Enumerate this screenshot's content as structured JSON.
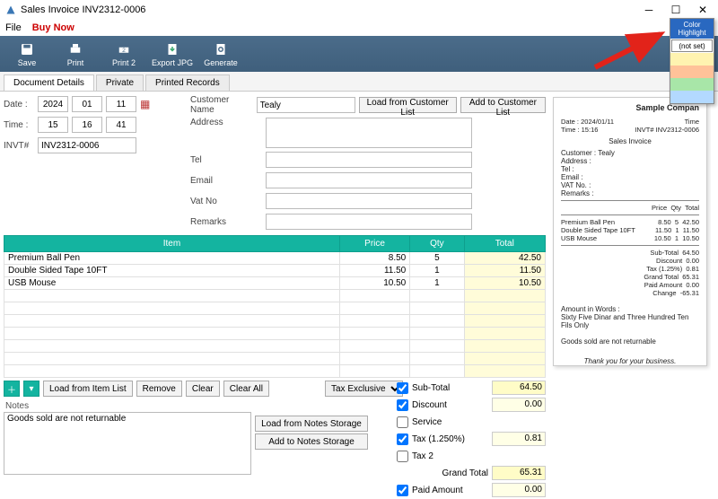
{
  "title": "Sales Invoice INV2312-0006",
  "menu": {
    "file": "File",
    "buy_now": "Buy Now"
  },
  "toolbar": {
    "save": "Save",
    "print": "Print",
    "print2": "Print 2",
    "exportjpg": "Export JPG",
    "generate": "Generate"
  },
  "tabs": {
    "doc": "Document Details",
    "private": "Private",
    "printed": "Printed Records"
  },
  "form": {
    "date_lbl": "Date :",
    "date_y": "2024",
    "date_m": "01",
    "date_d": "11",
    "time_lbl": "Time :",
    "time_h": "15",
    "time_m": "16",
    "time_s": "41",
    "invt_lbl": "INVT#",
    "invt": "INV2312-0006",
    "cust_lbl": "Customer Name",
    "cust": "Tealy",
    "load_cust": "Load from Customer List",
    "add_cust": "Add to Customer List",
    "addr_lbl": "Address",
    "addr": "",
    "tel_lbl": "Tel",
    "tel": "",
    "email_lbl": "Email",
    "email": "",
    "vat_lbl": "Vat No",
    "vat": "",
    "remarks_lbl": "Remarks",
    "remarks": ""
  },
  "item_cols": {
    "item": "Item",
    "price": "Price",
    "qty": "Qty",
    "total": "Total"
  },
  "items": [
    {
      "name": "Premium Ball Pen",
      "price": "8.50",
      "qty": "5",
      "total": "42.50"
    },
    {
      "name": "Double Sided Tape 10FT",
      "price": "11.50",
      "qty": "1",
      "total": "11.50"
    },
    {
      "name": "USB Mouse",
      "price": "10.50",
      "qty": "1",
      "total": "10.50"
    }
  ],
  "item_bar": {
    "load": "Load from Item List",
    "remove": "Remove",
    "clear": "Clear",
    "clear_all": "Clear All",
    "tax_mode": "Tax Exclusive"
  },
  "notes": {
    "header": "Notes",
    "text": "Goods sold are not returnable",
    "load": "Load from Notes Storage",
    "add": "Add to Notes Storage"
  },
  "totals": {
    "sub_lbl": "Sub-Total",
    "sub": "64.50",
    "disc_lbl": "Discount",
    "disc": "0.00",
    "svc_lbl": "Service",
    "tax_lbl": "Tax (1.250%)",
    "tax": "0.81",
    "tax2_lbl": "Tax 2",
    "grand_lbl": "Grand Total",
    "grand": "65.31",
    "paid_lbl": "Paid Amount",
    "paid": "0.00"
  },
  "preview": {
    "company": "Sample Compan",
    "date_lbl": "Date :",
    "date": "2024/01/11",
    "time_lbl": "Time",
    "time_prefix": "Time  : 15:16",
    "doc_title": "Sales Invoice",
    "docno_lbl": "INVT#",
    "docno": "INV2312-0006",
    "customer_lbl": "Customer :",
    "customer": "Tealy",
    "address_lbl": "Address :",
    "tel_lbl": "Tel :",
    "email_lbl": "Email :",
    "vat_lbl": "VAT No. :",
    "remarks_lbl": "Remarks :",
    "cols": {
      "price": "Price",
      "qty": "Qty",
      "total": "Total"
    },
    "items": [
      {
        "name": "Premium Ball Pen",
        "price": "8.50",
        "qty": "5",
        "total": "42.50"
      },
      {
        "name": "Double Sided Tape 10FT",
        "price": "11.50",
        "qty": "1",
        "total": "11.50"
      },
      {
        "name": "USB Mouse",
        "price": "10.50",
        "qty": "1",
        "total": "10.50"
      }
    ],
    "sub_lbl": "Sub-Total",
    "sub": "64.50",
    "disc_lbl": "Discount",
    "disc": "0.00",
    "tax_lbl": "Tax (1.25%)",
    "tax": "0.81",
    "grand_lbl": "Grand Total",
    "grand": "65.31",
    "paid_lbl": "Paid Amount",
    "paid": "0.00",
    "change_lbl": "Change",
    "change": "-65.31",
    "words_lbl": "Amount in Words :",
    "words": "Sixty Five Dinar and Three Hundred Ten Fils Only",
    "footer1": "Goods sold are not returnable",
    "footer2": "Thank you for your business."
  },
  "highlight": {
    "header": "Color Highlight",
    "not_set": "(not set)",
    "colors": [
      "#fff3b0",
      "#ffc299",
      "#a8e6a8",
      "#b3d9ff"
    ]
  }
}
